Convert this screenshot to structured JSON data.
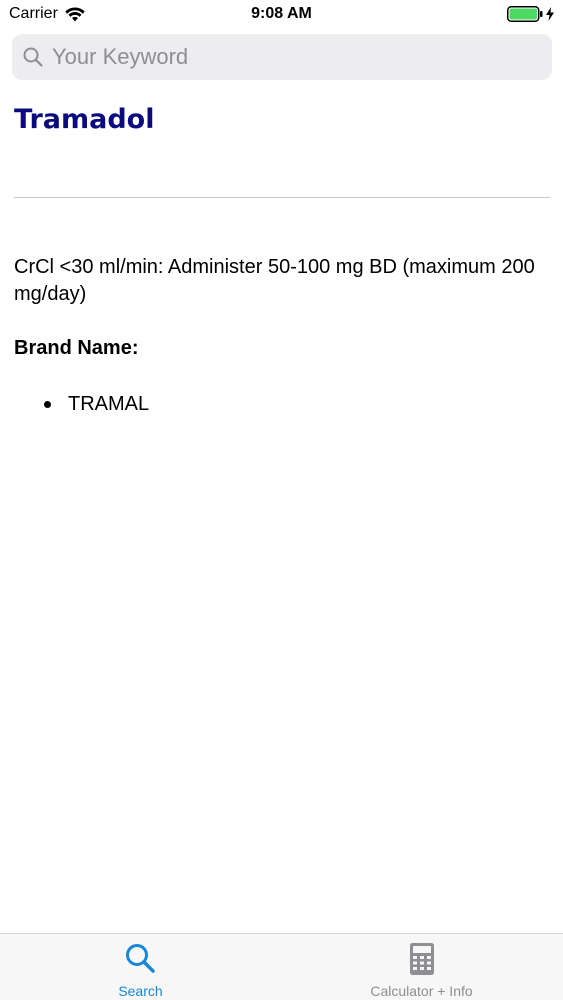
{
  "status_bar": {
    "carrier": "Carrier",
    "time": "9:08 AM",
    "battery_color": "#4cd964"
  },
  "search": {
    "placeholder": "Your Keyword",
    "value": ""
  },
  "drug": {
    "title": "Tramadol",
    "title_color": "#0b0b80",
    "dosing": "CrCl <30 ml/min: Administer 50-100 mg BD (maximum 200 mg/day)",
    "brand_heading": "Brand Name:",
    "brand_names": [
      "TRAMAL"
    ]
  },
  "tab_bar": {
    "tabs": [
      {
        "label": "Search",
        "icon": "search-icon",
        "active": true,
        "color": "#1a86d8"
      },
      {
        "label": "Calculator + Info",
        "icon": "calculator-icon",
        "active": false,
        "color": "#8e8e93"
      }
    ]
  }
}
